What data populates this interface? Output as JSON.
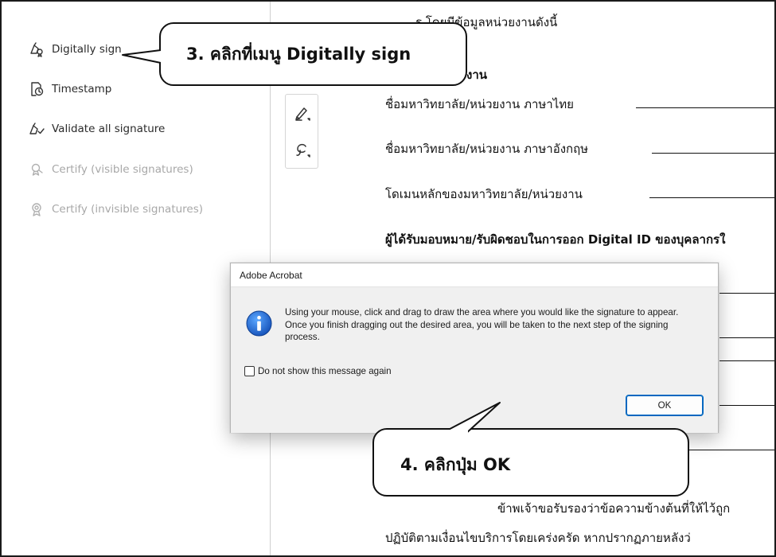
{
  "left_panel": {
    "items": [
      {
        "label": "Digitally sign",
        "icon": "digital-sign-icon",
        "enabled": true
      },
      {
        "label": "Timestamp",
        "icon": "timestamp-icon",
        "enabled": true
      },
      {
        "label": "Validate all signature",
        "icon": "validate-icon",
        "enabled": true
      },
      {
        "label": "Certify (visible signatures)",
        "icon": "certify-visible-icon",
        "enabled": false
      },
      {
        "label": "Certify (invisible signatures)",
        "icon": "certify-invisible-icon",
        "enabled": false
      }
    ]
  },
  "document": {
    "line_top": "ร โดยมีข้อมูลหน่วยงานดังนี้",
    "section_fragment": "งาน",
    "field_name_th": "ชื่อมหาวิทยาลัย/หน่วยงาน ภาษาไทย",
    "field_name_en": "ชื่อมหาวิทยาลัย/หน่วยงาน ภาษาอังกฤษ",
    "field_domain": "โดเมนหลักของมหาวิทยาลัย/หน่วยงาน",
    "heading_responsible": "ผู้ได้รับมอบหมาย/รับผิดชอบในการออก Digital ID ของบุคลากรใ",
    "certify_line": "ข้าพเจ้าขอรับรองว่าข้อความข้างต้นที่ให้ไว้ถูก",
    "comply_line": "ปฏิบัติตามเงื่อนไขบริการโดยเคร่งครัด หากปรากฏภายหลังว่"
  },
  "tools": [
    {
      "icon": "pen-icon"
    },
    {
      "icon": "lasso-icon"
    }
  ],
  "callouts": {
    "step3": "3. คลิกที่เมนู Digitally sign",
    "step4": "4. คลิกปุ่ม OK"
  },
  "dialog": {
    "title": "Adobe Acrobat",
    "icon": "info-icon",
    "message": "Using your mouse, click and drag to draw the area where you would like the signature to appear. Once you finish dragging out the desired area, you will be taken to the next step of the signing process.",
    "checkbox_label": "Do not show this message again",
    "checkbox_checked": false,
    "ok_label": "OK"
  },
  "colors": {
    "info_blue": "#1565c0",
    "ok_border": "#0067c0",
    "disabled_text": "#a8a8a8"
  }
}
